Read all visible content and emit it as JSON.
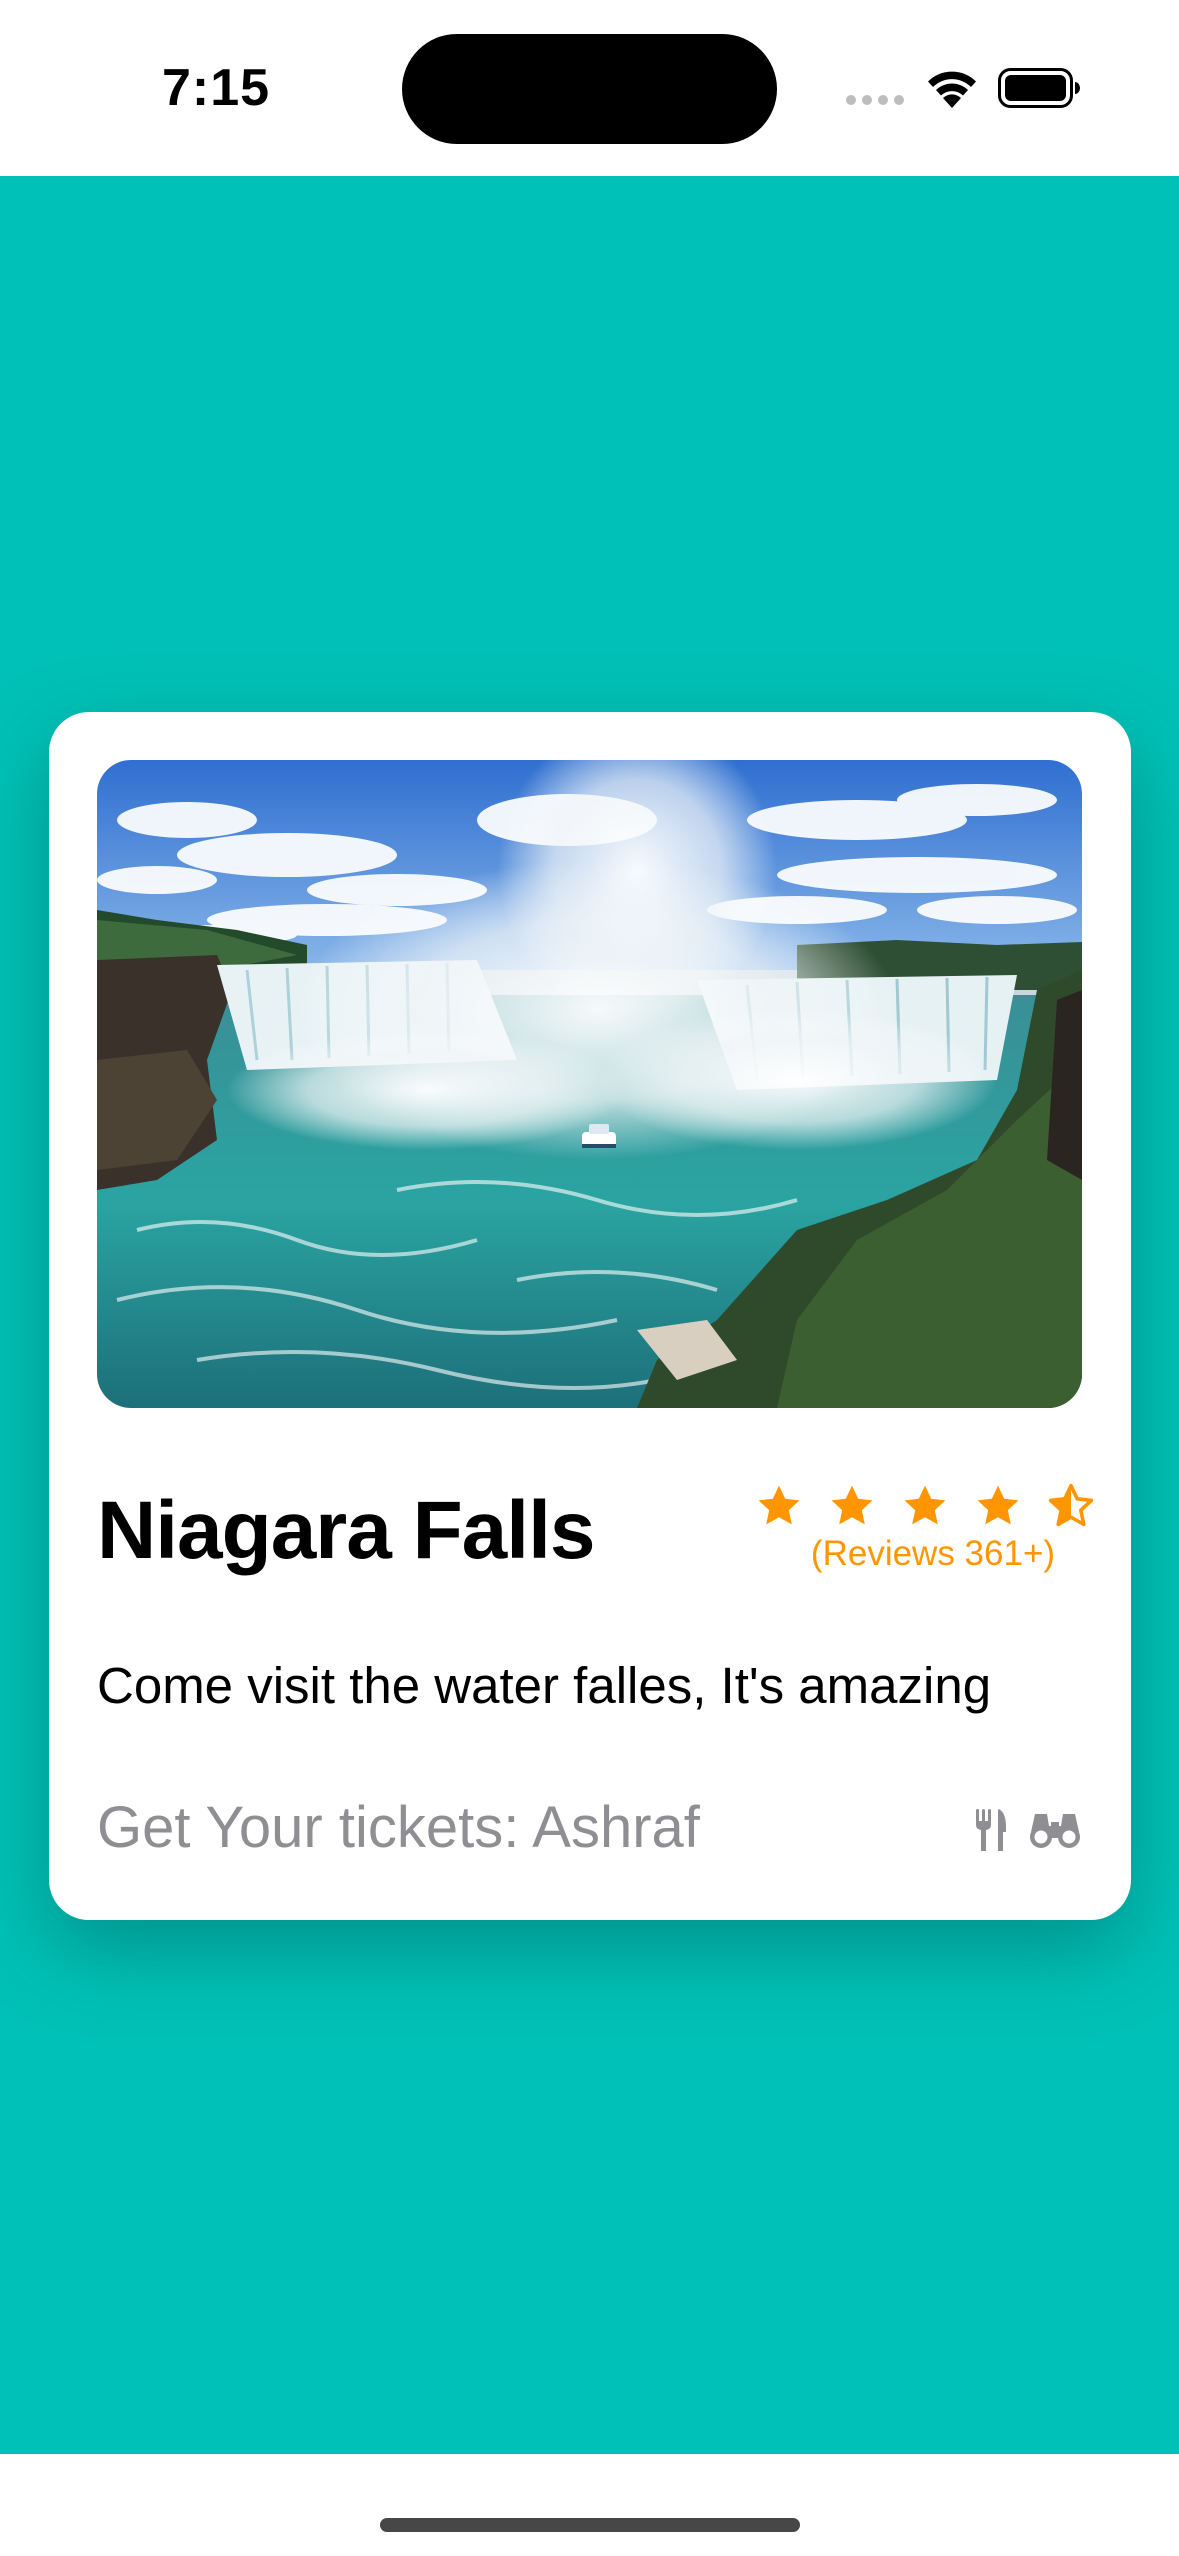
{
  "status_bar": {
    "time": "7:15"
  },
  "card": {
    "image_subject": "Niagara Falls horseshoe waterfall with tour boat",
    "title": "Niagara Falls",
    "rating": 4.5,
    "rating_max": 5,
    "reviews_label": "(Reviews 361+)",
    "description": "Come visit the water falles, It's amazing",
    "tickets_label": "Get Your tickets: Ashraf",
    "icons": [
      "fork-knife-icon",
      "binoculars-icon"
    ]
  },
  "colors": {
    "background": "#00c1b7",
    "card": "#ffffff",
    "star": "#ff9500",
    "secondary_text": "#8e8e93"
  }
}
